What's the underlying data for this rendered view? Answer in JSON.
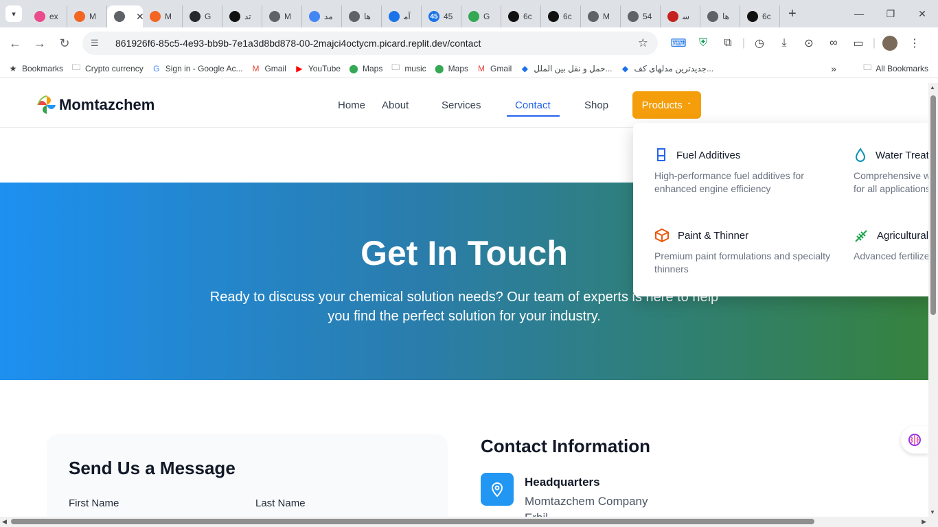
{
  "browser": {
    "tabs": [
      {
        "title": "ex",
        "color": "#e94b8b",
        "glyph": ""
      },
      {
        "title": "M",
        "color": "#f26522",
        "glyph": ""
      },
      {
        "title": "",
        "color": "#5f6368",
        "glyph": "",
        "active": true
      },
      {
        "title": "M",
        "color": "#f26522",
        "glyph": ""
      },
      {
        "title": "G",
        "color": "#24292e",
        "glyph": ""
      },
      {
        "title": "ﺗﺪ",
        "color": "#111111",
        "glyph": ""
      },
      {
        "title": "M",
        "color": "#5f6368",
        "glyph": ""
      },
      {
        "title": "ﻣﺪ",
        "color": "#4285f4",
        "glyph": ""
      },
      {
        "title": "ﻫﺎ",
        "color": "#5f6368",
        "glyph": ""
      },
      {
        "title": "آﻣ",
        "color": "#1a73e8",
        "glyph": ""
      },
      {
        "title": "45",
        "color": "#1a73e8",
        "glyph": "45"
      },
      {
        "title": "G",
        "color": "#34a853",
        "glyph": ""
      },
      {
        "title": "6c",
        "color": "#111111",
        "glyph": ""
      },
      {
        "title": "6c",
        "color": "#111111",
        "glyph": ""
      },
      {
        "title": "M",
        "color": "#5f6368",
        "glyph": ""
      },
      {
        "title": "54",
        "color": "#5f6368",
        "glyph": ""
      },
      {
        "title": "ﺳ",
        "color": "#c5221f",
        "glyph": ""
      },
      {
        "title": "ﻫﺎ",
        "color": "#5f6368",
        "glyph": ""
      },
      {
        "title": "6c",
        "color": "#111111",
        "glyph": ""
      }
    ],
    "url": "861926f6-85c5-4e93-bb9b-7e1a3d8bd878-00-2majci4octycm.picard.replit.dev/contact",
    "bookmarks": [
      {
        "label": "Bookmarks",
        "icon": "star-icon"
      },
      {
        "label": "Crypto currency",
        "icon": "folder-icon"
      },
      {
        "label": "Sign in - Google Ac...",
        "icon": "google-icon"
      },
      {
        "label": "Gmail",
        "icon": "gmail-icon"
      },
      {
        "label": "YouTube",
        "icon": "youtube-icon"
      },
      {
        "label": "Maps",
        "icon": "maps-icon"
      },
      {
        "label": "music",
        "icon": "folder-icon"
      },
      {
        "label": "Maps",
        "icon": "maps-icon"
      },
      {
        "label": "Gmail",
        "icon": "gmail-icon"
      },
      {
        "label": "حمل و نقل بین الملل...",
        "icon": "site-icon"
      },
      {
        "label": "جدیدترین مدلهای کف...",
        "icon": "site-icon"
      }
    ],
    "all_bookmarks": "All Bookmarks"
  },
  "site": {
    "logo_text": "Momtazchem",
    "nav": {
      "home": "Home",
      "about": "About",
      "services": "Services",
      "contact": "Contact",
      "shop": "Shop",
      "products": "Products"
    },
    "hero": {
      "title": "Get In Touch",
      "subtitle": "Ready to discuss your chemical solution needs? Our team of experts is here to help you find the perfect solution for your industry."
    },
    "form": {
      "title": "Send Us a Message",
      "first_name_label": "First Name",
      "last_name_label": "Last Name"
    },
    "contact_info": {
      "title": "Contact Information",
      "hq_title": "Headquarters",
      "hq_line1": "Momtazchem Company",
      "hq_line2": "Erbil"
    },
    "products_menu": [
      {
        "title": "Fuel Additives",
        "desc": "High-performance fuel additives for enhanced engine efficiency",
        "icon": "beaker-icon",
        "color": "#2563eb"
      },
      {
        "title": "Water Treatment",
        "desc": "Comprehensive water treatment solutions for all applications",
        "icon": "droplet-icon",
        "color": "#0891b2"
      },
      {
        "title": "Paint & Thinner",
        "desc": "Premium paint formulations and specialty thinners",
        "icon": "box-icon",
        "color": "#ea580c"
      },
      {
        "title": "Agricultural Fertilizers",
        "desc": "Advanced fertilizers for sustainable farming",
        "icon": "wheat-icon",
        "color": "#16a34a"
      }
    ],
    "colors": {
      "accent": "#2563eb",
      "products_button": "#f59e0b",
      "hero_start": "#1d90f0",
      "hero_end": "#36823e"
    }
  }
}
